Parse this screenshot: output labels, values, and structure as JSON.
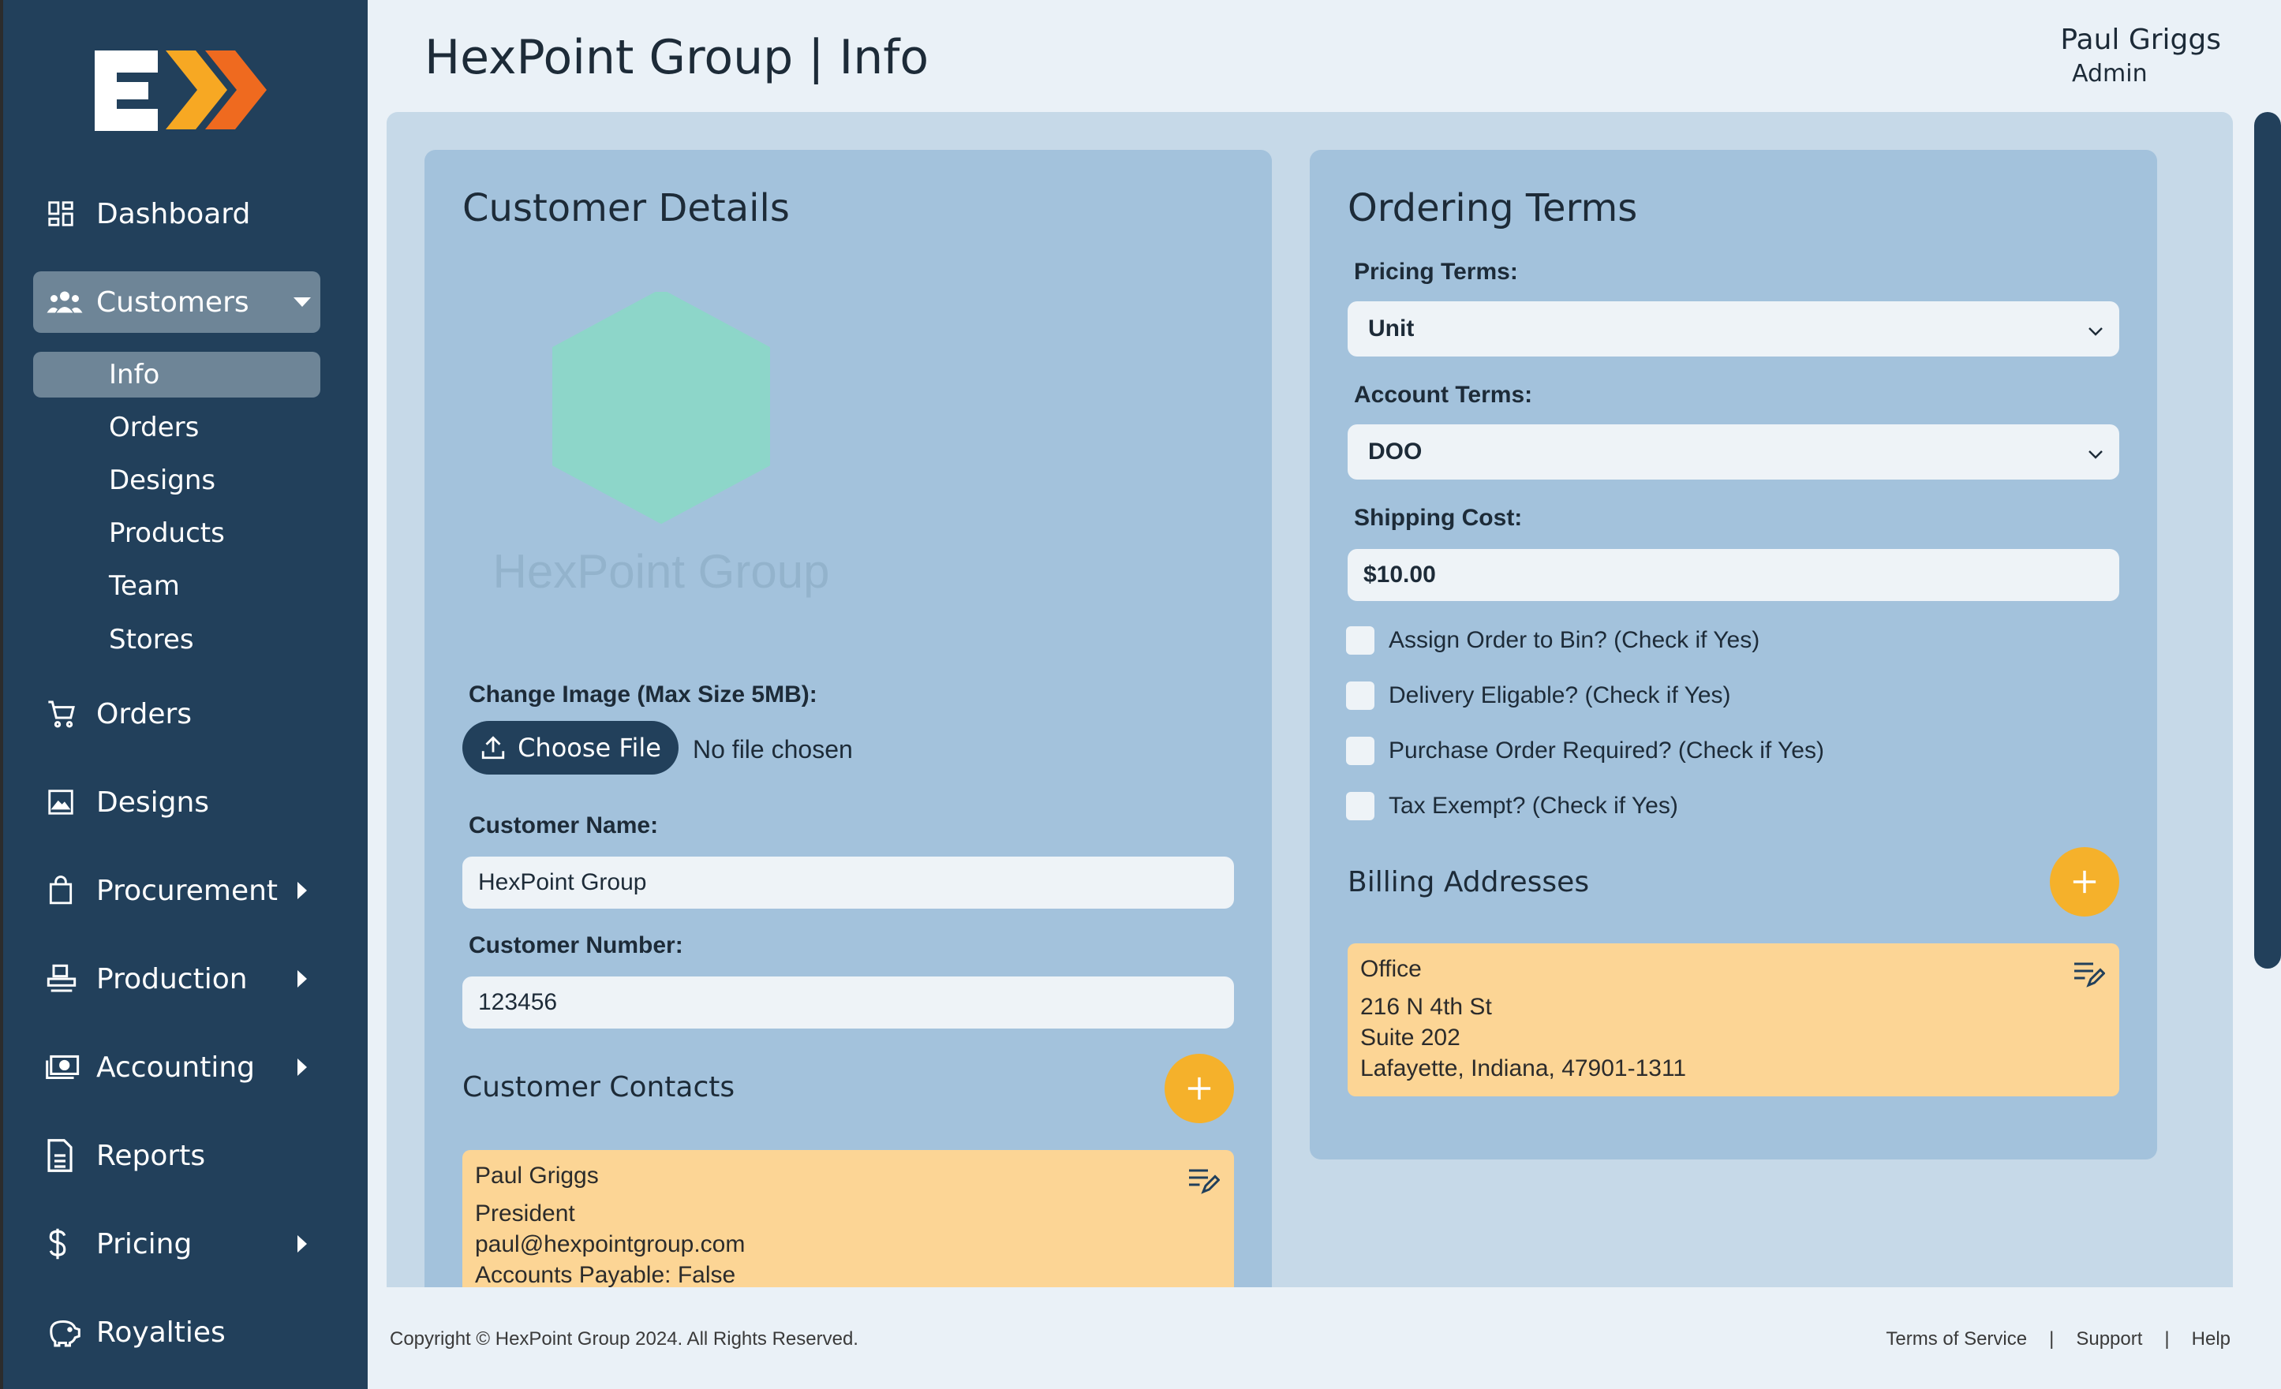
{
  "header": {
    "title": "HexPoint Group | Info",
    "user_name": "Paul Griggs",
    "user_role": "Admin"
  },
  "sidebar": {
    "items": [
      {
        "label": "Dashboard",
        "icon": "dashboard-icon"
      },
      {
        "label": "Customers",
        "icon": "users-icon"
      },
      {
        "label": "Orders",
        "icon": "cart-icon"
      },
      {
        "label": "Designs",
        "icon": "image-icon"
      },
      {
        "label": "Procurement",
        "icon": "bag-icon"
      },
      {
        "label": "Production",
        "icon": "production-icon"
      },
      {
        "label": "Accounting",
        "icon": "money-icon"
      },
      {
        "label": "Reports",
        "icon": "document-icon"
      },
      {
        "label": "Pricing",
        "icon": "dollar-icon"
      },
      {
        "label": "Royalties",
        "icon": "piggy-bank-icon"
      }
    ],
    "customers_sub": [
      "Info",
      "Orders",
      "Designs",
      "Products",
      "Team",
      "Stores"
    ]
  },
  "customer_details": {
    "title": "Customer Details",
    "logo_caption": "HexPoint Group",
    "image_label": "Change Image (Max Size 5MB):",
    "choose_file_label": "Choose File",
    "no_file_text": "No file chosen",
    "name_label": "Customer Name:",
    "name_value": "HexPoint Group",
    "number_label": "Customer Number:",
    "number_value": "123456",
    "contacts_title": "Customer Contacts",
    "contact": {
      "name": "Paul Griggs",
      "title": "President",
      "email": "paul@hexpointgroup.com",
      "ap": "Accounts Payable: False"
    }
  },
  "ordering_terms": {
    "title": "Ordering Terms",
    "pricing_label": "Pricing Terms:",
    "pricing_value": "Unit",
    "account_label": "Account Terms:",
    "account_value": "DOO",
    "shipping_label": "Shipping Cost:",
    "shipping_value": "$10.00",
    "checkboxes": [
      "Assign Order to Bin? (Check if Yes)",
      "Delivery Eligable? (Check if Yes)",
      "Purchase Order Required? (Check if Yes)",
      "Tax Exempt? (Check if Yes)"
    ],
    "billing_title": "Billing Addresses",
    "address": {
      "name": "Office",
      "line1": "216 N 4th St",
      "line2": "Suite 202",
      "line3": "Lafayette, Indiana, 47901-1311"
    }
  },
  "footer": {
    "copyright": "Copyright © HexPoint Group 2024. All Rights Reserved.",
    "links": [
      "Terms of Service",
      "|",
      "Support",
      "|",
      "Help"
    ]
  },
  "colors": {
    "sidebar": "#22405b",
    "accent": "#f5b12b",
    "card": "#a3c2dc",
    "panel": "#c6d9e8",
    "note": "#fcd595"
  }
}
